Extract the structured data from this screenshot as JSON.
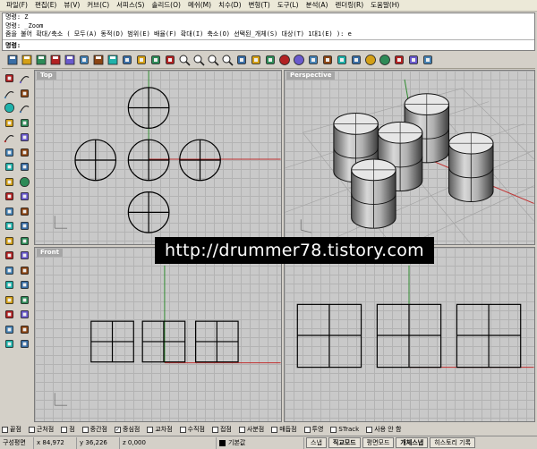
{
  "menubar": {
    "items": [
      "파일(F)",
      "편집(E)",
      "뷰(V)",
      "커브(C)",
      "서피스(S)",
      "솔리드(O)",
      "메쉬(M)",
      "치수(D)",
      "변형(T)",
      "도구(L)",
      "분석(A)",
      "렌더링(R)",
      "도움말(H)"
    ]
  },
  "command": {
    "history": [
      "명령: Z",
      "명령: _Zoom",
      "줌을 불어 확대/축소 ( 모두(A) 동적(D) 범위(E) 배율(F) 확대(I) 축소(O) 선택된_개체(S) 대상(T) 1대1(E) ): e"
    ],
    "prompt": "명령:"
  },
  "toolbar": {
    "icons": [
      "new-file-icon",
      "open-folder-icon",
      "save-icon",
      "print-icon",
      "save-small-icon",
      "cut-icon",
      "copy-icon",
      "paste-icon",
      "undo-icon",
      "redo-icon",
      "pan-hand-icon",
      "rotate-view-icon",
      "zoom-dynamic-icon",
      "zoom-window-icon",
      "zoom-extents-icon",
      "zoom-selected-icon",
      "grid-icon",
      "layout-icon",
      "layers-icon",
      "shaded-sphere-icon",
      "rendered-sphere-icon",
      "camera-icon",
      "light-icon",
      "color-palette-icon",
      "material-icon",
      "blue-sphere-icon",
      "globe-icon",
      "gear-icon",
      "tools-icon",
      "help-icon"
    ]
  },
  "lefttools": {
    "icons": [
      "point-icon",
      "polyline-icon",
      "line-icon",
      "rectangle-icon",
      "circle-icon",
      "arc-icon",
      "ellipse-icon",
      "polygon-icon",
      "curve-icon",
      "text-icon",
      "fillet-icon",
      "offset-icon",
      "surface-icon",
      "surface-edit-icon",
      "solid-box-icon",
      "solid-sphere-icon",
      "extrude-icon",
      "loft-icon",
      "mesh-icon",
      "mesh-edit-icon",
      "transform-icon",
      "explode-icon",
      "join-icon",
      "trim-icon",
      "split-icon",
      "move-icon",
      "array-icon",
      "mirror-icon",
      "scale-icon",
      "rotate-icon",
      "group-icon",
      "ungroup-icon",
      "dimension-icon",
      "annotation-icon",
      "analyze-icon",
      "render-icon",
      "block-icon",
      "display-icon"
    ]
  },
  "viewports": {
    "top": "Top",
    "perspective": "Perspective",
    "front": "Front",
    "right": ""
  },
  "watermark": "http://drummer78.tistory.com",
  "osnap": {
    "items": [
      {
        "label": "끝점",
        "checked": false
      },
      {
        "label": "근처점",
        "checked": false
      },
      {
        "label": "점",
        "checked": false
      },
      {
        "label": "중간점",
        "checked": false
      },
      {
        "label": "중심점",
        "checked": true
      },
      {
        "label": "교차점",
        "checked": false
      },
      {
        "label": "수직점",
        "checked": false
      },
      {
        "label": "접점",
        "checked": false
      },
      {
        "label": "사분점",
        "checked": false
      },
      {
        "label": "매듭점",
        "checked": false
      },
      {
        "label": "투영",
        "checked": false
      },
      {
        "label": "STrack",
        "checked": false
      },
      {
        "label": "사용 안 함",
        "checked": false
      }
    ]
  },
  "status": {
    "cplane": "구성평면",
    "x": "x 84,972",
    "y": "y 36,226",
    "z": "z 0,000",
    "layer": "기본값",
    "buttons": [
      "스냅",
      "직교모드",
      "평면모드",
      "개체스냅",
      "히스토리 기록"
    ],
    "active_buttons": [
      "직교모드",
      "개체스냅"
    ]
  }
}
